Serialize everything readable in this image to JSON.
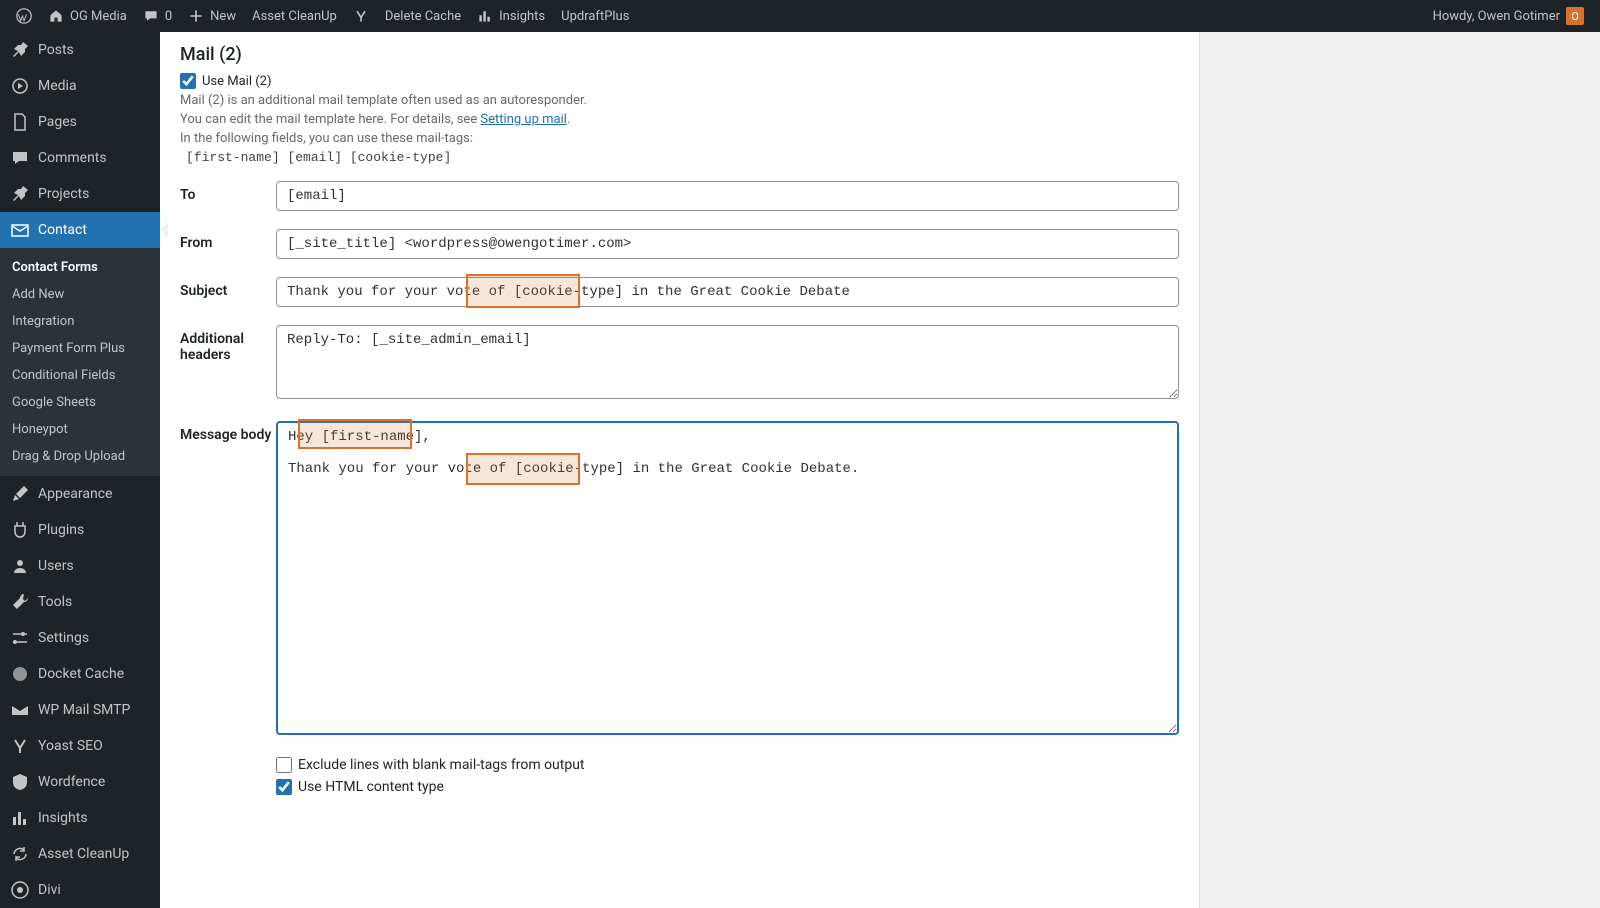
{
  "adminbar": {
    "site_name": "OG Media",
    "comments_count": "0",
    "new_label": "New",
    "items": [
      "Asset CleanUp",
      "",
      "Delete Cache",
      "Insights",
      "UpdraftPlus"
    ],
    "howdy": "Howdy, Owen Gotimer",
    "avatar_initial": "O"
  },
  "sidebar": {
    "items": [
      {
        "label": "Posts",
        "icon": "pin"
      },
      {
        "label": "Media",
        "icon": "media"
      },
      {
        "label": "Pages",
        "icon": "page"
      },
      {
        "label": "Comments",
        "icon": "comment"
      },
      {
        "label": "Projects",
        "icon": "pin"
      },
      {
        "label": "Contact",
        "icon": "mail",
        "current": true
      },
      {
        "label": "Appearance",
        "icon": "brush"
      },
      {
        "label": "Plugins",
        "icon": "plugin"
      },
      {
        "label": "Users",
        "icon": "users"
      },
      {
        "label": "Tools",
        "icon": "tools"
      },
      {
        "label": "Settings",
        "icon": "settings"
      },
      {
        "label": "Docket Cache",
        "icon": "circle"
      },
      {
        "label": "WP Mail SMTP",
        "icon": "mailwing"
      },
      {
        "label": "Yoast SEO",
        "icon": "yoast"
      },
      {
        "label": "Wordfence",
        "icon": "shield"
      },
      {
        "label": "Insights",
        "icon": "chart"
      },
      {
        "label": "Asset CleanUp",
        "icon": "refresh"
      },
      {
        "label": "Divi",
        "icon": "divi"
      }
    ],
    "submenu": [
      "Contact Forms",
      "Add New",
      "Integration",
      "Payment Form Plus",
      "Conditional Fields",
      "Google Sheets",
      "Honeypot",
      "Drag & Drop Upload"
    ]
  },
  "panel": {
    "title": "Mail (2)",
    "use_mail_label": "Use Mail (2)",
    "use_mail_checked": true,
    "desc1": "Mail (2) is an additional mail template often used as an autoresponder.",
    "desc2_pre": "You can edit the mail template here. For details, see ",
    "desc2_link": "Setting up mail",
    "desc2_post": ".",
    "desc3": "In the following fields, you can use these mail-tags:",
    "tags": "[first-name] [email] [cookie-type]",
    "fields": {
      "to_label": "To",
      "to_value": "[email]",
      "from_label": "From",
      "from_value": "[_site_title] <wordpress@owengotimer.com>",
      "subject_label": "Subject",
      "subject_value": "Thank you for your vote of [cookie-type] in the Great Cookie Debate",
      "headers_label": "Additional headers",
      "headers_value": "Reply-To: [_site_admin_email]",
      "body_label": "Message body",
      "body_value": "Hey [first-name],\n\nThank you for your vote of [cookie-type] in the Great Cookie Debate."
    },
    "options": {
      "exclude_label": "Exclude lines with blank mail-tags from output",
      "exclude_checked": false,
      "html_label": "Use HTML content type",
      "html_checked": true
    },
    "highlights": {
      "subject_tag": "[cookie-type]",
      "body_tags": [
        "[first-name],",
        "[cookie-type]"
      ]
    }
  }
}
